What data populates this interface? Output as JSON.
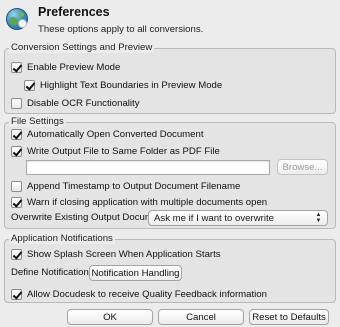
{
  "header": {
    "title": "Preferences",
    "subtitle": "These options apply to all conversions.",
    "logo_icon": "docudesk-globe-icon"
  },
  "conversion_group": {
    "title": "Conversion Settings and Preview",
    "enable_preview": {
      "label": "Enable Preview Mode",
      "checked": true
    },
    "highlight_boundaries": {
      "label": "Highlight Text Boundaries in Preview Mode",
      "checked": true
    },
    "disable_ocr": {
      "label": "Disable OCR Functionality",
      "checked": false
    }
  },
  "file_group": {
    "title": "File Settings",
    "auto_open": {
      "label": "Automatically Open Converted Document",
      "checked": true
    },
    "write_same_folder": {
      "label": "Write Output File to Same Folder as PDF File",
      "checked": true
    },
    "output_path": {
      "value": "",
      "placeholder": ""
    },
    "browse_label": "Browse...",
    "append_timestamp": {
      "label": "Append Timestamp to Output Document Filename",
      "checked": false
    },
    "warn_closing": {
      "label": "Warn if closing application with multiple documents open",
      "checked": true
    },
    "overwrite_label": "Overwrite Existing Output Document:",
    "overwrite_selected": "Ask me if I want to overwrite"
  },
  "notifications_group": {
    "title": "Application Notifications",
    "splash_screen": {
      "label": "Show Splash Screen When Application Starts",
      "checked": true
    },
    "define_label": "Define Notifications:",
    "notification_handling_label": "Notification Handling",
    "quality_feedback": {
      "label": "Allow Docudesk to receive Quality Feedback information",
      "checked": true
    }
  },
  "footer": {
    "ok_label": "OK",
    "cancel_label": "Cancel",
    "reset_label": "Reset to Defaults"
  },
  "colors": {
    "window_bg": "#ececec",
    "group_bg": "#e4e4e4",
    "border": "#b9b9b9"
  }
}
